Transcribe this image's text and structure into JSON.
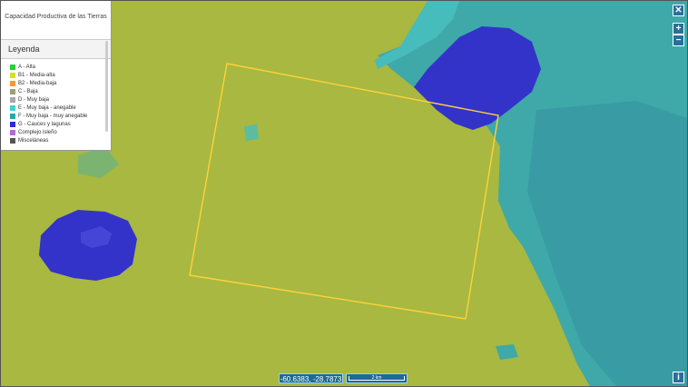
{
  "panel": {
    "title": "Capacidad Productiva de las Tierras",
    "legend_header": "Leyenda",
    "legend": [
      {
        "label": "A - Alta",
        "color": "#19d63a"
      },
      {
        "label": "B1 - Media-alta",
        "color": "#d6e21a"
      },
      {
        "label": "B2 - Media-baja",
        "color": "#f0a020"
      },
      {
        "label": "C - Baja",
        "color": "#9c9c7a"
      },
      {
        "label": "D - Muy baja",
        "color": "#a8a8a8"
      },
      {
        "label": "E - Muy baja - anegable",
        "color": "#3fd0d0"
      },
      {
        "label": "F - Muy baja - muy anegable",
        "color": "#27a8a8"
      },
      {
        "label": "G - Cauces y lagunas",
        "color": "#2a2ad0"
      },
      {
        "label": "Complejo isleño",
        "color": "#b36ad9"
      },
      {
        "label": "Misceláneas",
        "color": "#555555"
      }
    ]
  },
  "controls": {
    "close_label": "✕",
    "zoom_in_label": "+",
    "zoom_out_label": "−",
    "info_label": "i"
  },
  "status": {
    "coordinates": "-60.6383, -28.7873",
    "scale_label": "2 km"
  }
}
